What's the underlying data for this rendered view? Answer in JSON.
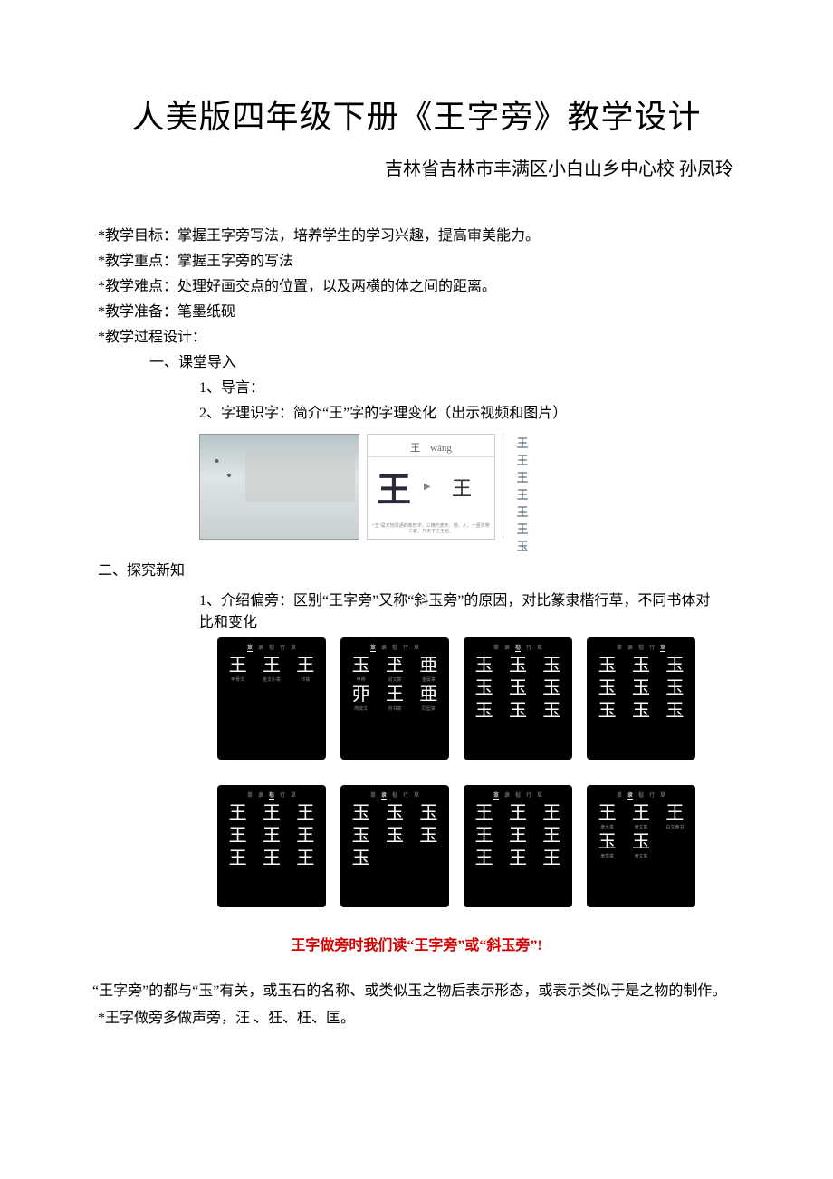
{
  "title": "人美版四年级下册《王字旁》教学设计",
  "subtitle": "吉林省吉林市丰满区小白山乡中心校 孙凤玲",
  "goals": {
    "objective_label": "*教学目标：",
    "objective_text": "掌握王字旁写法，培养学生的学习兴趣，提高审美能力。",
    "focus_label": "*教学重点：",
    "focus_text": "掌握王字旁的写法",
    "difficulty_label": "*教学难点：",
    "difficulty_text": "处理好画交点的位置，以及两横的体之间的距离。",
    "prep_label": "*教学准备：",
    "prep_text": "笔墨纸砚",
    "process_label": "*教学过程设计："
  },
  "section1": {
    "heading": "一、课堂导入",
    "item1": "1、导言：",
    "item2": "2、字理识字：简介“王”字的字理变化（出示视频和图片）"
  },
  "panel2": {
    "header": "王　wáng",
    "big": "王",
    "small": "王",
    "caption": "“王”是天地贯通的象形字，三横代表天、地、人，一竖贯穿三者，乃天下之王也。"
  },
  "panel3": [
    "王",
    "王",
    "王",
    "王",
    "王",
    "王",
    "玉"
  ],
  "section2": {
    "heading": "二、探究新知",
    "item1": "1、介绍偏旁：区别“王字旁”又称“斜玉旁”的原因，对比篆隶楷行草，不同书体对比和变化"
  },
  "style_cards_row1": [
    {
      "tabs": [
        "篆",
        "隶",
        "楷",
        "行",
        "草"
      ],
      "active": 0,
      "rows": [
        [
          {
            "ch": "王",
            "lbl": "甲骨文"
          },
          {
            "ch": "王",
            "lbl": "金文小篆"
          },
          {
            "ch": "王",
            "lbl": "印篆"
          }
        ]
      ]
    },
    {
      "tabs": [
        "篆",
        "隶",
        "楷",
        "行",
        "草"
      ],
      "active": 0,
      "rows": [
        [
          {
            "ch": "玉",
            "lbl": "甲骨"
          },
          {
            "ch": "玊",
            "lbl": "说文篆"
          },
          {
            "ch": "亜",
            "lbl": "金属篆"
          }
        ],
        [
          {
            "ch": "丣",
            "lbl": "简牍文"
          },
          {
            "ch": "王",
            "lbl": "帛书篆"
          },
          {
            "ch": "亜",
            "lbl": "同型篆"
          }
        ]
      ]
    },
    {
      "tabs": [
        "篆",
        "隶",
        "楷",
        "行",
        "草"
      ],
      "active": 2,
      "rows": [
        [
          {
            "ch": "玉",
            "lbl": ""
          },
          {
            "ch": "玉",
            "lbl": ""
          },
          {
            "ch": "玉",
            "lbl": ""
          }
        ],
        [
          {
            "ch": "玉",
            "lbl": ""
          },
          {
            "ch": "玉",
            "lbl": ""
          },
          {
            "ch": "玉",
            "lbl": ""
          }
        ],
        [
          {
            "ch": "玉",
            "lbl": ""
          },
          {
            "ch": "玉",
            "lbl": ""
          },
          {
            "ch": "玉",
            "lbl": ""
          }
        ]
      ]
    },
    {
      "tabs": [
        "篆",
        "隶",
        "楷",
        "行",
        "草"
      ],
      "active": 4,
      "rows": [
        [
          {
            "ch": "玉",
            "lbl": ""
          },
          {
            "ch": "玉",
            "lbl": ""
          },
          {
            "ch": "玉",
            "lbl": ""
          }
        ],
        [
          {
            "ch": "玉",
            "lbl": ""
          },
          {
            "ch": "玉",
            "lbl": ""
          },
          {
            "ch": "玉",
            "lbl": ""
          }
        ],
        [
          {
            "ch": "玉",
            "lbl": ""
          },
          {
            "ch": "玉",
            "lbl": ""
          },
          {
            "ch": "玉",
            "lbl": ""
          }
        ]
      ]
    }
  ],
  "style_cards_row2": [
    {
      "tabs": [
        "篆",
        "隶",
        "楷",
        "行",
        "草"
      ],
      "active": 2,
      "rows": [
        [
          {
            "ch": "王",
            "lbl": ""
          },
          {
            "ch": "王",
            "lbl": ""
          },
          {
            "ch": "王",
            "lbl": ""
          }
        ],
        [
          {
            "ch": "王",
            "lbl": ""
          },
          {
            "ch": "王",
            "lbl": ""
          },
          {
            "ch": "王",
            "lbl": ""
          }
        ],
        [
          {
            "ch": "王",
            "lbl": ""
          },
          {
            "ch": "王",
            "lbl": ""
          },
          {
            "ch": "王",
            "lbl": ""
          }
        ]
      ]
    },
    {
      "tabs": [
        "篆",
        "隶",
        "楷",
        "行",
        "草"
      ],
      "active": 1,
      "rows": [
        [
          {
            "ch": "玉",
            "lbl": ""
          },
          {
            "ch": "玉",
            "lbl": ""
          },
          {
            "ch": "玉",
            "lbl": ""
          }
        ],
        [
          {
            "ch": "玉",
            "lbl": ""
          },
          {
            "ch": "玉",
            "lbl": ""
          },
          {
            "ch": "玉",
            "lbl": ""
          }
        ],
        [
          {
            "ch": "玉",
            "lbl": ""
          },
          {
            "ch": "",
            "lbl": ""
          },
          {
            "ch": "",
            "lbl": ""
          }
        ]
      ]
    },
    {
      "tabs": [
        "篆",
        "隶",
        "楷",
        "行",
        "草"
      ],
      "active": 0,
      "rows": [
        [
          {
            "ch": "王",
            "lbl": ""
          },
          {
            "ch": "王",
            "lbl": ""
          },
          {
            "ch": "王",
            "lbl": ""
          }
        ],
        [
          {
            "ch": "王",
            "lbl": ""
          },
          {
            "ch": "王",
            "lbl": ""
          },
          {
            "ch": "王",
            "lbl": ""
          }
        ],
        [
          {
            "ch": "王",
            "lbl": ""
          },
          {
            "ch": "王",
            "lbl": ""
          },
          {
            "ch": "王",
            "lbl": ""
          }
        ]
      ]
    },
    {
      "tabs": [
        "篆",
        "隶",
        "楷",
        "行",
        "草"
      ],
      "active": 1,
      "rows": [
        [
          {
            "ch": "王",
            "lbl": "隶大篆"
          },
          {
            "ch": "王",
            "lbl": "隶文篆"
          },
          {
            "ch": "王",
            "lbl": "白文隶书"
          }
        ],
        [
          {
            "ch": "玉",
            "lbl": "隶草篆"
          },
          {
            "ch": "玉",
            "lbl": "隶文篆"
          },
          {
            "ch": "",
            "lbl": ""
          }
        ]
      ]
    }
  ],
  "red_line": "王字做旁时我们读“王字旁”或“斜玉旁”!",
  "body1": "“王字旁”的都与“玉”有关，或玉石的名称、或类似玉之物后表示形态，或表示类似于是之物的制作。",
  "body2": "*王字做旁多做声旁，汪 、狂、枉、匡。"
}
